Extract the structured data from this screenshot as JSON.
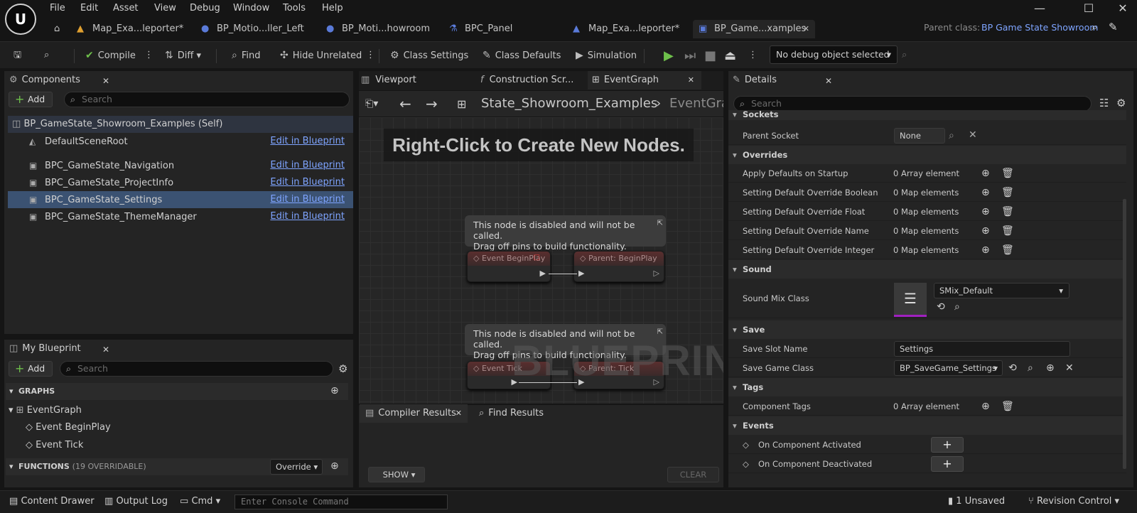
{
  "menu": [
    "File",
    "Edit",
    "Asset",
    "View",
    "Debug",
    "Window",
    "Tools",
    "Help"
  ],
  "tabs": [
    {
      "label": "Map_Exa...leporter*"
    },
    {
      "label": "BP_Motio...ller_Left"
    },
    {
      "label": "BP_Moti...howroom"
    },
    {
      "label": "BPC_Panel"
    },
    {
      "label": "Map_Exa...leporter*"
    },
    {
      "label": "BP_Game...xamples"
    }
  ],
  "parent_class_label": "Parent class:",
  "parent_class_value": "BP Game State Showroom",
  "toolbar": {
    "compile": "Compile",
    "diff": "Diff",
    "find": "Find",
    "hide_unrelated": "Hide Unrelated",
    "class_settings": "Class Settings",
    "class_defaults": "Class Defaults",
    "simulation": "Simulation",
    "debug_object": "No debug object selected"
  },
  "components": {
    "title": "Components",
    "add": "Add",
    "search_placeholder": "Search",
    "root": "BP_GameState_Showroom_Examples (Self)",
    "items": [
      {
        "label": "DefaultSceneRoot",
        "edit": "Edit in Blueprint"
      },
      {
        "label": "BPC_GameState_Navigation",
        "edit": "Edit in Blueprint"
      },
      {
        "label": "BPC_GameState_ProjectInfo",
        "edit": "Edit in Blueprint"
      },
      {
        "label": "BPC_GameState_Settings",
        "edit": "Edit in Blueprint"
      },
      {
        "label": "BPC_GameState_ThemeManager",
        "edit": "Edit in Blueprint"
      }
    ]
  },
  "my_blueprint": {
    "title": "My Blueprint",
    "add": "Add",
    "search_placeholder": "Search",
    "graphs_header": "GRAPHS",
    "event_graph": "EventGraph",
    "event_beginplay": "Event BeginPlay",
    "event_tick": "Event Tick",
    "functions_header": "FUNCTIONS",
    "functions_count": "(19 OVERRIDABLE)",
    "override": "Override"
  },
  "editor_tabs": {
    "viewport": "Viewport",
    "construction": "Construction Scr...",
    "eventgraph": "EventGraph"
  },
  "graph": {
    "breadcrumb_1": "State_Showroom_Examples",
    "breadcrumb_2": "EventGra",
    "hint": "Right-Click to Create New Nodes.",
    "bubble_1_line1": "This node is disabled and will not be called.",
    "bubble_1_line2": "Drag off pins to build functionality.",
    "bubble_2_line1": "This node is disabled and will not be called.",
    "bubble_2_line2": "Drag off pins to build functionality.",
    "node_beginplay": "Event BeginPlay",
    "node_parent_beginplay": "Parent: BeginPlay",
    "node_tick": "Event Tick",
    "node_parent_tick": "Parent: Tick",
    "watermark": "BLUEPRINT"
  },
  "bottom_tabs": {
    "compiler_results": "Compiler Results",
    "find_results": "Find Results",
    "show": "SHOW",
    "clear": "CLEAR"
  },
  "details": {
    "title": "Details",
    "search_placeholder": "Search",
    "sockets_header": "Sockets",
    "parent_socket_label": "Parent Socket",
    "parent_socket_value": "None",
    "overrides_header": "Overrides",
    "apply_defaults_label": "Apply Defaults on Startup",
    "apply_defaults_value": "0 Array element",
    "bool_label": "Setting Default Override Boolean",
    "bool_value": "0 Map elements",
    "float_label": "Setting Default Override Float",
    "float_value": "0 Map elements",
    "name_label": "Setting Default Override Name",
    "name_value": "0 Map elements",
    "int_label": "Setting Default Override Integer",
    "int_value": "0 Map elements",
    "sound_header": "Sound",
    "sound_mix_label": "Sound Mix Class",
    "sound_mix_value": "SMix_Default",
    "save_header": "Save",
    "save_slot_label": "Save Slot Name",
    "save_slot_value": "Settings",
    "save_game_label": "Save Game Class",
    "save_game_value": "BP_SaveGame_Settings",
    "tags_header": "Tags",
    "tags_label": "Component Tags",
    "tags_value": "0 Array element",
    "events_header": "Events",
    "on_activated": "On Component Activated",
    "on_deactivated": "On Component Deactivated"
  },
  "status": {
    "content_drawer": "Content Drawer",
    "output_log": "Output Log",
    "cmd": "Cmd",
    "console_placeholder": "Enter Console Command",
    "unsaved": "1 Unsaved",
    "revision": "Revision Control"
  }
}
